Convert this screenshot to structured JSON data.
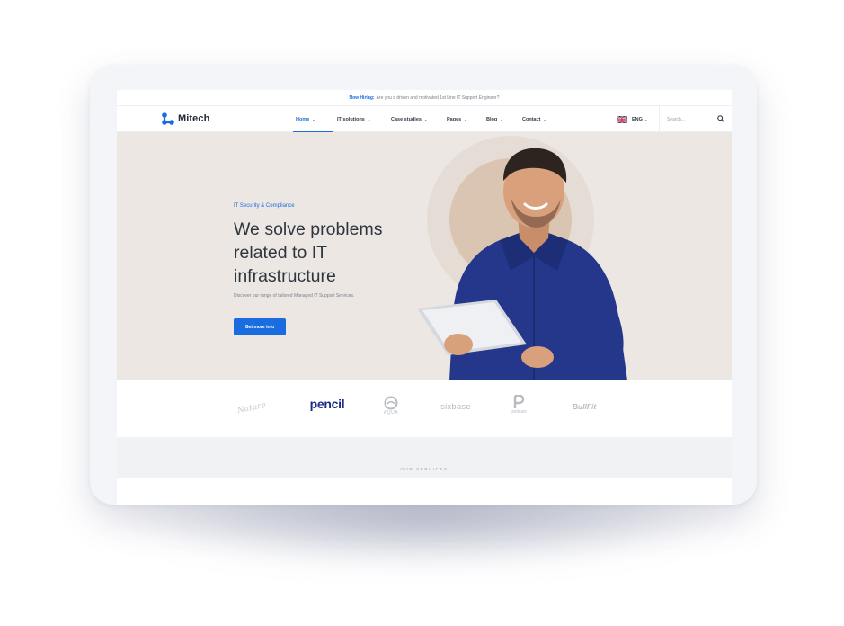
{
  "topbar": {
    "highlight": "Now Hiring:",
    "message": "Are you a driven and motivated 1st Line IT Support Engineer?"
  },
  "brand": {
    "name": "Mitech",
    "accent_color": "#1a6de0"
  },
  "nav": {
    "items": [
      {
        "label": "Home",
        "active": true
      },
      {
        "label": "IT solutions",
        "active": false
      },
      {
        "label": "Case studies",
        "active": false
      },
      {
        "label": "Pages",
        "active": false
      },
      {
        "label": "Blog",
        "active": false
      },
      {
        "label": "Contact",
        "active": false
      }
    ],
    "chevron": "⌄",
    "language": "ENG",
    "flag_icon": "uk-flag-icon"
  },
  "search": {
    "placeholder": "Search...",
    "icon": "search-icon"
  },
  "hero": {
    "eyebrow": "IT Security & Compliance",
    "headline": "We solve problems related to IT infrastructure",
    "subtext": "Discover our range of tailored Managed IT Support Services.",
    "cta_label": "Get more info",
    "background_color": "#ece7e2"
  },
  "brands": {
    "script_logo": "Nature",
    "pencil": "pencil",
    "aqua": "AQUA",
    "sixbase": "sixbase",
    "pelican": "pelican",
    "bullfit": "BullFit"
  },
  "services": {
    "label": "OUR SERVICES"
  }
}
